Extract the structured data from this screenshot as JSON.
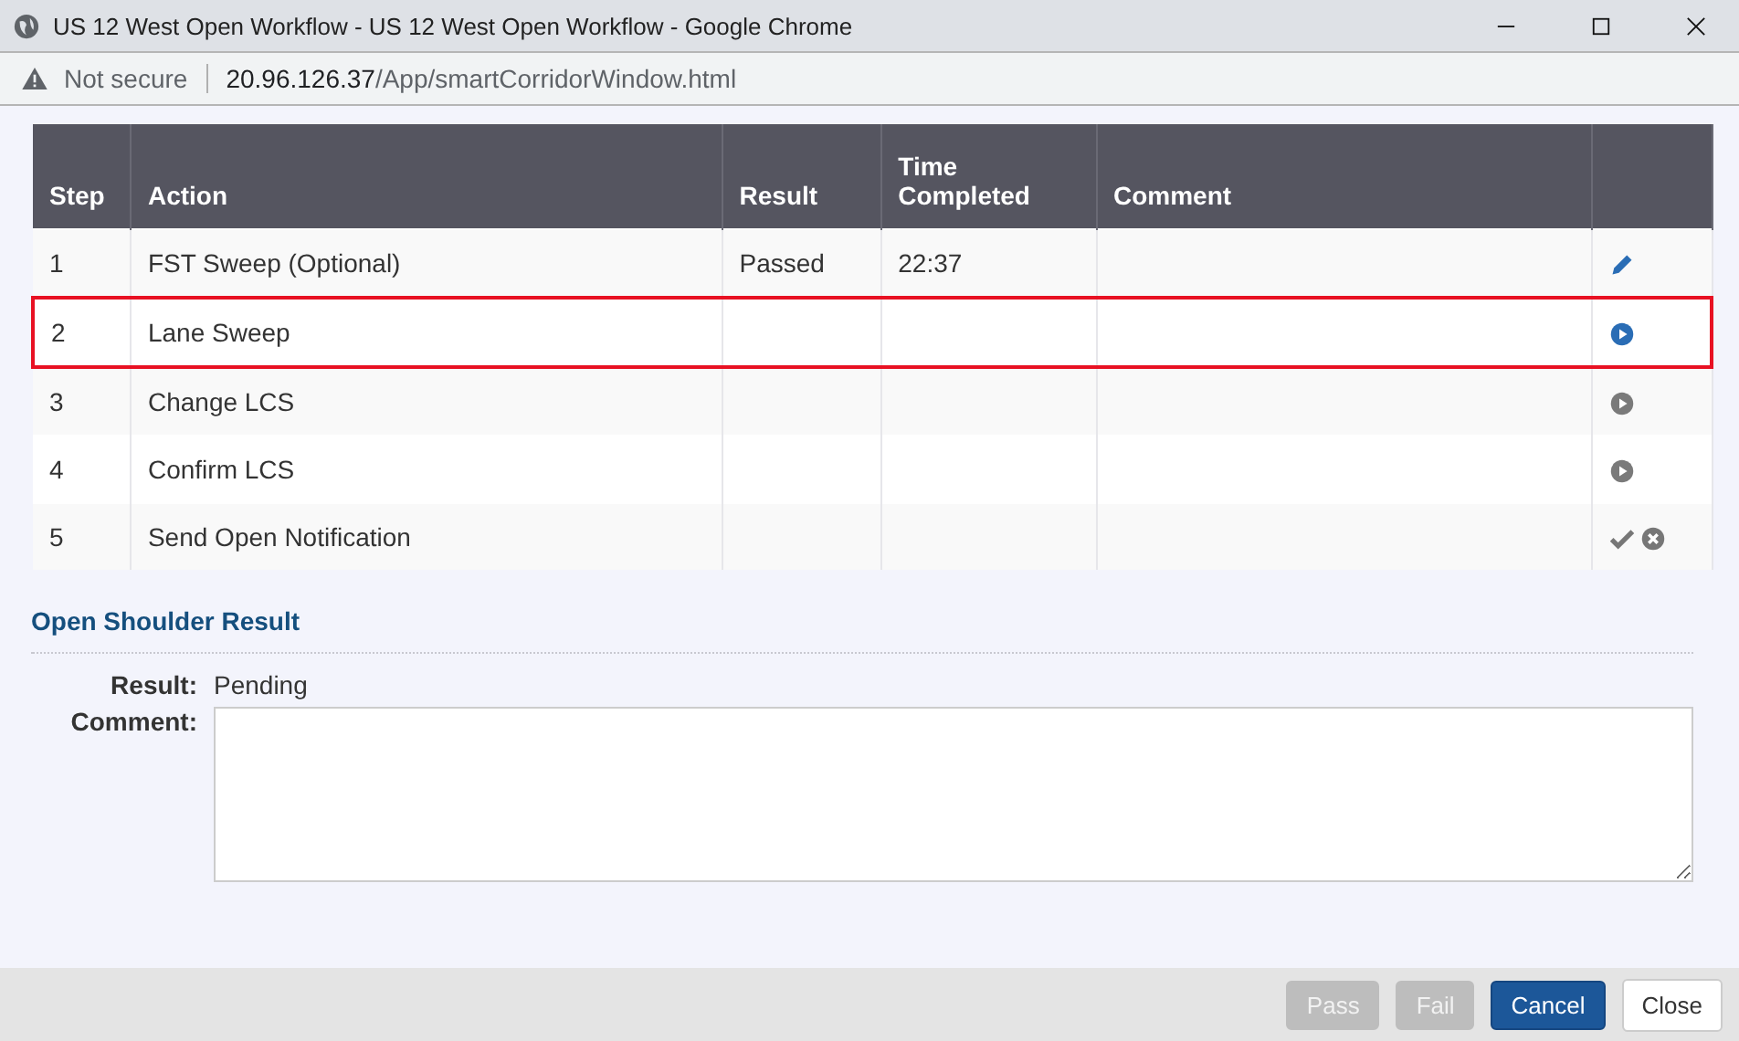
{
  "window": {
    "title": "US 12 West Open Workflow - US 12 West Open Workflow - Google Chrome"
  },
  "address_bar": {
    "security": "Not secure",
    "host": "20.96.126.37",
    "path": "/App/smartCorridorWindow.html"
  },
  "table": {
    "columns": [
      "Step",
      "Action",
      "Result",
      "Time Completed",
      "Comment"
    ],
    "rows": [
      {
        "step": "1",
        "action": "FST Sweep (Optional)",
        "result": "Passed",
        "time": "22:37",
        "selected": false,
        "kind": "edit"
      },
      {
        "step": "2",
        "action": "Lane Sweep",
        "selected": true,
        "kind": "play",
        "active": true
      },
      {
        "step": "3",
        "action": "Change LCS",
        "selected": false,
        "kind": "play",
        "active": false
      },
      {
        "step": "4",
        "action": "Confirm LCS",
        "selected": false,
        "kind": "play",
        "active": false
      },
      {
        "step": "5",
        "action": "Send Open Notification",
        "selected": false,
        "kind": "confirm"
      }
    ]
  },
  "result_section": {
    "title": "Open Shoulder Result",
    "result_label": "Result:",
    "result_value": "Pending",
    "comment_label": "Comment:"
  },
  "buttons": [
    {
      "label": "Pass",
      "disabled": true,
      "kind": "default"
    },
    {
      "label": "Fail",
      "disabled": true,
      "kind": "default"
    },
    {
      "label": "Cancel",
      "disabled": false,
      "kind": "primary"
    },
    {
      "label": "Close",
      "disabled": false,
      "kind": "plain"
    }
  ]
}
